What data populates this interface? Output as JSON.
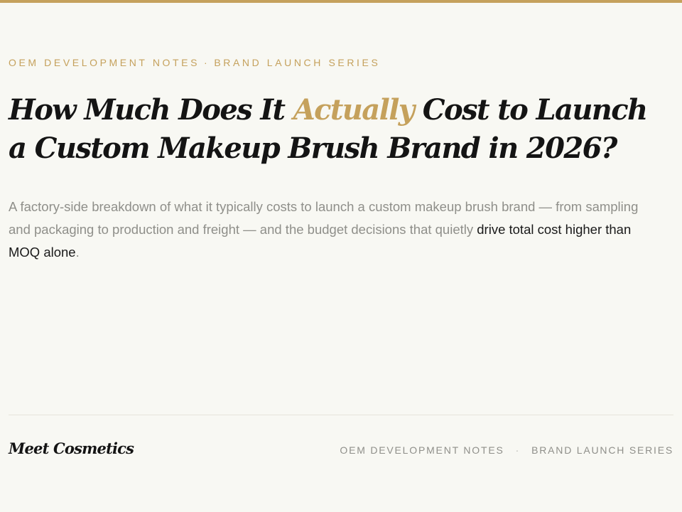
{
  "header": {
    "eyebrow_left": "OEM DEVELOPMENT NOTES",
    "eyebrow_sep": "·",
    "eyebrow_right": "BRAND LAUNCH SERIES"
  },
  "article": {
    "title_part1": "How Much Does It ",
    "title_accent": "Actually",
    "title_part2": " Cost to Launch a Custom Makeup Brush Brand in 2026?",
    "dek_part1": "A factory-side breakdown of what it typically costs to launch a custom makeup brush brand — from sampling and packaging to production and freight — and the budget decisions that quietly ",
    "dek_emphasis": "drive total cost higher than MOQ alone",
    "dek_end": "."
  },
  "footer": {
    "brand": "Meet Cosmetics",
    "nav_left": "OEM DEVELOPMENT NOTES",
    "nav_sep": "·",
    "nav_right": "BRAND LAUNCH SERIES"
  },
  "colors": {
    "accent": "#c5a15c",
    "background": "#f8f8f3",
    "text_dark": "#141414",
    "text_muted": "#8f8f8a"
  }
}
